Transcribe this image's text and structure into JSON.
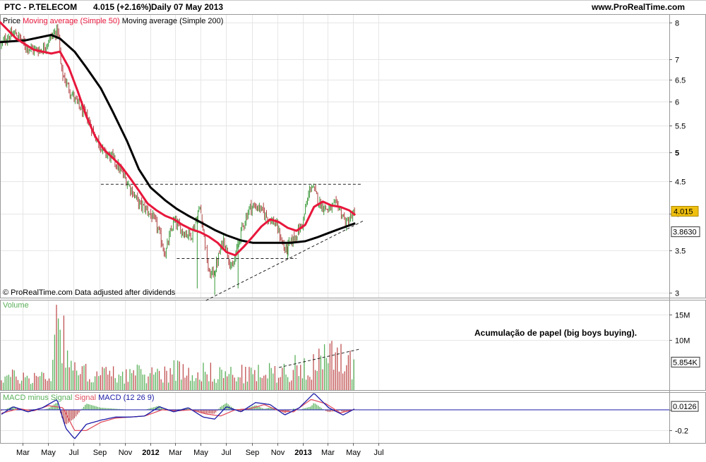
{
  "header": {
    "symbol": "PTC - P.TELECOM",
    "quote": "4.015 (+2.16%)",
    "period": "Daily 07 May 2013",
    "site": "www.ProRealTime.com"
  },
  "colors": {
    "price_up": "#3a9a3a",
    "price_down": "#b04040",
    "sma50": "#e8173c",
    "sma200": "#000000",
    "volume_up": "#5ab05a",
    "volume_down": "#c05050",
    "macd": "#1a1aa8",
    "signal": "#e05060",
    "grid": "#e6e6e6",
    "price_badge": "#f0c010",
    "zero_line": "#1a1aa8"
  },
  "chart_data": [
    {
      "type": "line",
      "panel": "price",
      "legend": [
        "Price",
        "Moving average (Simple 50)",
        "Moving average (Simple 200)"
      ],
      "x_ticks": [
        "Mar",
        "May",
        "Jul",
        "Sep",
        "Nov",
        "2012",
        "Mar",
        "May",
        "Jul",
        "Sep",
        "Nov",
        "2013",
        "Mar",
        "May",
        "Jul"
      ],
      "y_ticks": [
        "8",
        "7",
        "6.5",
        "6",
        "5.5",
        "5",
        "4.5",
        "4",
        "3.5",
        "3"
      ],
      "ylim": [
        2.95,
        8.25
      ],
      "y_scale": "log",
      "last_price_label": "4.015",
      "last_sma200_label": "3.8630",
      "footer": "© ProRealTime.com  Data adjusted after dividends",
      "price": {
        "x": [
          "2011-01-03",
          "2011-01-24",
          "2011-02-14",
          "2011-03-07",
          "2011-03-28",
          "2011-04-18",
          "2011-05-09",
          "2011-05-25",
          "2011-06-02",
          "2011-06-20",
          "2011-07-11",
          "2011-08-01",
          "2011-08-22",
          "2011-09-12",
          "2011-10-03",
          "2011-10-24",
          "2011-11-14",
          "2011-12-05",
          "2011-12-26",
          "2012-01-16",
          "2012-02-06",
          "2012-02-27",
          "2012-03-19",
          "2012-04-09",
          "2012-04-30",
          "2012-05-21",
          "2012-06-04",
          "2012-06-25",
          "2012-07-16",
          "2012-08-06",
          "2012-08-27",
          "2012-09-17",
          "2012-10-08",
          "2012-10-29",
          "2012-11-19",
          "2012-12-10",
          "2012-12-31",
          "2013-01-21",
          "2013-02-11",
          "2013-03-04",
          "2013-03-25",
          "2013-04-15",
          "2013-05-07"
        ],
        "values": [
          7.3,
          7.6,
          7.7,
          7.35,
          7.25,
          7.25,
          7.6,
          7.8,
          6.7,
          6.3,
          5.95,
          5.7,
          5.3,
          5.0,
          4.9,
          4.65,
          4.4,
          4.15,
          4.05,
          3.85,
          3.45,
          3.9,
          3.75,
          3.7,
          4.1,
          3.2,
          3.25,
          3.65,
          3.25,
          3.75,
          4.1,
          4.1,
          3.95,
          3.85,
          3.5,
          3.65,
          3.85,
          4.45,
          4.15,
          4.05,
          4.15,
          3.85,
          4.015
        ]
      },
      "sma50": {
        "x": [
          "2011-01-03",
          "2011-02-14",
          "2011-03-28",
          "2011-05-09",
          "2011-05-30",
          "2011-06-20",
          "2011-07-11",
          "2011-08-01",
          "2011-08-22",
          "2011-09-12",
          "2011-10-03",
          "2011-10-24",
          "2011-11-14",
          "2011-12-05",
          "2011-12-26",
          "2012-01-16",
          "2012-02-06",
          "2012-02-27",
          "2012-03-19",
          "2012-04-09",
          "2012-04-30",
          "2012-05-21",
          "2012-06-11",
          "2012-07-02",
          "2012-07-23",
          "2012-08-13",
          "2012-09-03",
          "2012-09-24",
          "2012-10-15",
          "2012-11-05",
          "2012-11-26",
          "2012-12-17",
          "2013-01-07",
          "2013-01-28",
          "2013-02-18",
          "2013-03-11",
          "2013-04-01",
          "2013-04-22",
          "2013-05-07"
        ],
        "values": [
          8.05,
          7.55,
          7.25,
          7.15,
          7.2,
          6.8,
          6.25,
          5.7,
          5.3,
          5.05,
          4.9,
          4.75,
          4.55,
          4.35,
          4.15,
          4.05,
          3.97,
          3.92,
          3.84,
          3.78,
          3.74,
          3.68,
          3.6,
          3.48,
          3.44,
          3.55,
          3.68,
          3.82,
          3.92,
          3.88,
          3.8,
          3.76,
          3.84,
          4.1,
          4.18,
          4.12,
          4.1,
          4.05,
          3.98
        ]
      },
      "sma200": {
        "x": [
          "2011-01-03",
          "2011-03-07",
          "2011-05-09",
          "2011-05-30",
          "2011-07-04",
          "2011-08-01",
          "2011-09-05",
          "2011-10-03",
          "2011-11-07",
          "2011-12-05",
          "2012-01-02",
          "2012-02-06",
          "2012-03-05",
          "2012-04-02",
          "2012-05-07",
          "2012-06-04",
          "2012-07-02",
          "2012-08-06",
          "2012-09-03",
          "2012-10-01",
          "2012-11-05",
          "2012-12-03",
          "2013-01-07",
          "2013-02-04",
          "2013-03-04",
          "2013-04-01",
          "2013-05-07"
        ],
        "values": [
          7.45,
          7.5,
          7.65,
          7.55,
          7.2,
          6.8,
          6.3,
          5.8,
          5.2,
          4.7,
          4.4,
          4.2,
          4.07,
          3.97,
          3.86,
          3.77,
          3.7,
          3.63,
          3.6,
          3.6,
          3.6,
          3.6,
          3.62,
          3.67,
          3.73,
          3.79,
          3.863
        ]
      },
      "annotations": [
        {
          "type": "resistance",
          "x": [
            "2011-09-05",
            "2013-05-20"
          ],
          "y": [
            4.45,
            4.45
          ]
        },
        {
          "type": "support",
          "x": [
            "2012-03-05",
            "2012-12-17"
          ],
          "y": [
            3.4,
            3.4
          ]
        },
        {
          "type": "trendline",
          "x": [
            "2012-05-14",
            "2013-05-27"
          ],
          "y": [
            2.92,
            3.9
          ]
        }
      ]
    },
    {
      "type": "bar",
      "panel": "volume",
      "label": "Volume",
      "y_ticks": [
        "15M",
        "10M"
      ],
      "last_label": "5.854K",
      "annotation_text": "Acumulação de papel (big boys buying).",
      "values_millions": {
        "x": [
          "2011-01-03",
          "2011-03-07",
          "2011-05-09",
          "2011-05-23",
          "2011-07-04",
          "2011-09-05",
          "2011-11-07",
          "2012-01-02",
          "2012-03-05",
          "2012-05-07",
          "2012-07-02",
          "2012-09-03",
          "2012-11-05",
          "2013-01-07",
          "2013-03-04",
          "2013-05-07"
        ],
        "avg": [
          3.0,
          2.8,
          3.2,
          17.0,
          4.0,
          3.5,
          3.5,
          3.5,
          4.5,
          4.0,
          3.5,
          3.5,
          4.0,
          5.5,
          6.5,
          5.854
        ],
        "peaks": [
          {
            "x": "2011-05-23",
            "v": 17.0
          },
          {
            "x": "2013-04-01",
            "v": 9.2
          },
          {
            "x": "2013-03-11",
            "v": 9.8
          }
        ]
      },
      "trendline": {
        "x": [
          "2012-11-05",
          "2013-05-20"
        ],
        "y": [
          4.5,
          8.2
        ]
      }
    },
    {
      "type": "area",
      "panel": "macd",
      "legend": [
        "MACD minus Signal",
        "Signal",
        "MACD (12 26 9)"
      ],
      "y_ticks": [
        "0",
        "-0.2"
      ],
      "last_label": "0.0126",
      "macd": {
        "x": [
          "2011-01-03",
          "2011-02-07",
          "2011-03-14",
          "2011-04-18",
          "2011-05-23",
          "2011-06-13",
          "2011-07-04",
          "2011-08-01",
          "2011-09-05",
          "2011-10-10",
          "2011-11-14",
          "2011-12-19",
          "2012-01-23",
          "2012-02-27",
          "2012-04-02",
          "2012-05-07",
          "2012-06-04",
          "2012-07-02",
          "2012-08-06",
          "2012-09-10",
          "2012-10-15",
          "2012-11-19",
          "2012-12-24",
          "2013-01-28",
          "2013-03-04",
          "2013-04-08",
          "2013-05-07"
        ],
        "values": [
          -0.06,
          0.03,
          -0.02,
          0.02,
          0.1,
          -0.18,
          -0.28,
          -0.14,
          -0.1,
          -0.07,
          -0.07,
          -0.06,
          0.03,
          -0.02,
          0.02,
          -0.07,
          -0.09,
          0.03,
          -0.02,
          0.07,
          0.05,
          -0.05,
          0.02,
          0.16,
          0.02,
          -0.05,
          0.0126
        ]
      },
      "signal": {
        "x": [
          "2011-01-03",
          "2011-02-21",
          "2011-03-28",
          "2011-05-02",
          "2011-06-06",
          "2011-07-04",
          "2011-08-01",
          "2011-09-05",
          "2011-10-10",
          "2011-11-14",
          "2011-12-19",
          "2012-01-30",
          "2012-03-05",
          "2012-04-09",
          "2012-05-14",
          "2012-06-18",
          "2012-07-23",
          "2012-08-27",
          "2012-10-01",
          "2012-11-05",
          "2012-12-10",
          "2013-01-21",
          "2013-02-25",
          "2013-04-01",
          "2013-05-07"
        ],
        "values": [
          -0.04,
          0.01,
          -0.01,
          0.04,
          0.02,
          -0.2,
          -0.2,
          -0.12,
          -0.08,
          -0.07,
          -0.06,
          0.0,
          -0.01,
          0.0,
          -0.04,
          -0.06,
          0.0,
          0.01,
          0.05,
          -0.01,
          -0.02,
          0.1,
          0.06,
          -0.03,
          0.005
        ]
      },
      "ylim": [
        -0.32,
        0.17
      ]
    }
  ]
}
